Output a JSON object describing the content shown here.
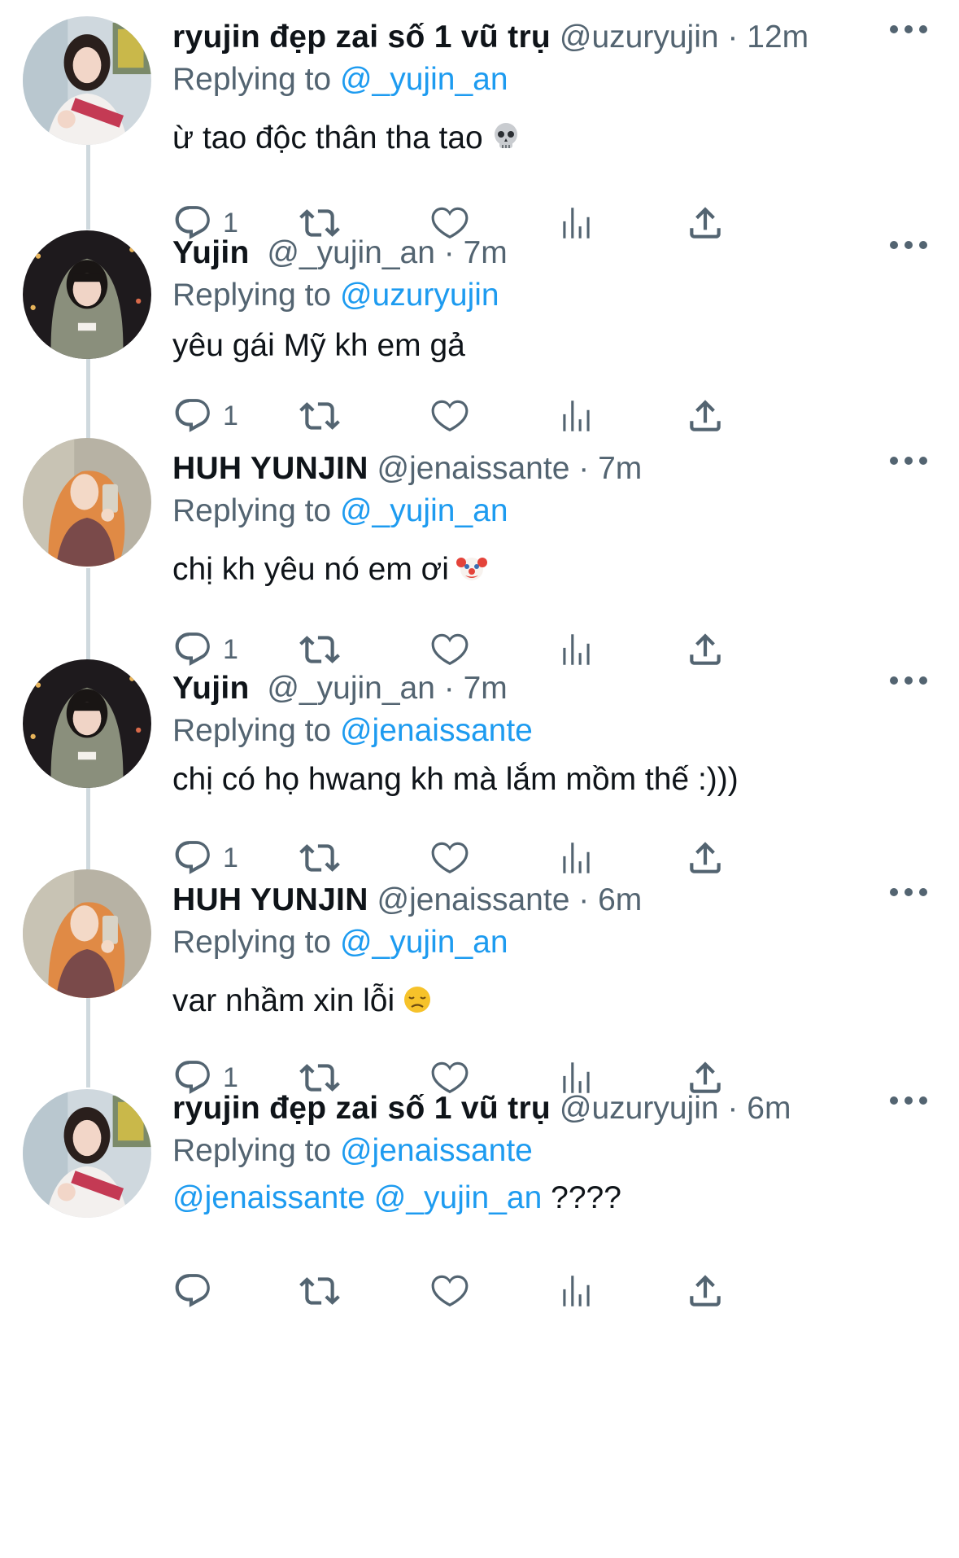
{
  "colors": {
    "accent": "#1d9bf0",
    "muted": "#536471",
    "text": "#0f1419",
    "thread_line": "#cfd9de"
  },
  "tweets": [
    {
      "name": "ryujin đẹp zai số 1 vũ trụ",
      "handle": "@uzuryujin",
      "sep": " · ",
      "time": "12m",
      "replying_prefix": "Replying to ",
      "replying_to": "@_yujin_an",
      "text": "ừ tao độc thân tha tao",
      "emoji": "skull-emoji",
      "reply_count": "1",
      "avatar": "avatar-ryujin"
    },
    {
      "name": "Yujin",
      "handle": "@_yujin_an",
      "sep": " · ",
      "time": "7m",
      "replying_prefix": "Replying to ",
      "replying_to": "@uzuryujin",
      "text": "yêu gái Mỹ kh em gả",
      "emoji": "",
      "reply_count": "1",
      "avatar": "avatar-yujin"
    },
    {
      "name": "HUH YUNJIN",
      "handle": "@jenaissante",
      "sep": " · ",
      "time": "7m",
      "replying_prefix": "Replying to ",
      "replying_to": "@_yujin_an",
      "text": "chị kh yêu nó em ơi",
      "emoji": "clown-emoji",
      "reply_count": "1",
      "avatar": "avatar-yunjin"
    },
    {
      "name": "Yujin",
      "handle": "@_yujin_an",
      "sep": " · ",
      "time": "7m",
      "replying_prefix": "Replying to ",
      "replying_to": "@jenaissante",
      "text": "chị có họ hwang kh mà lắm mồm thế :)))",
      "emoji": "",
      "reply_count": "1",
      "avatar": "avatar-yujin"
    },
    {
      "name": "HUH YUNJIN",
      "handle": "@jenaissante",
      "sep": " · ",
      "time": "6m",
      "replying_prefix": "Replying to ",
      "replying_to": "@_yujin_an",
      "text": "var nhầm xin lỗi",
      "emoji": "disappointed-emoji",
      "reply_count": "1",
      "avatar": "avatar-yunjin"
    },
    {
      "name": "ryujin đẹp zai số 1 vũ trụ",
      "handle": "@uzuryujin",
      "sep": " · ",
      "time": "6m",
      "replying_prefix": "Replying to ",
      "replying_to": "@jenaissante",
      "text_mention_1": "@jenaissante",
      "text_mention_2": "@_yujin_an",
      "text_tail": "????",
      "emoji": "",
      "reply_count": "",
      "avatar": "avatar-ryujin"
    }
  ]
}
